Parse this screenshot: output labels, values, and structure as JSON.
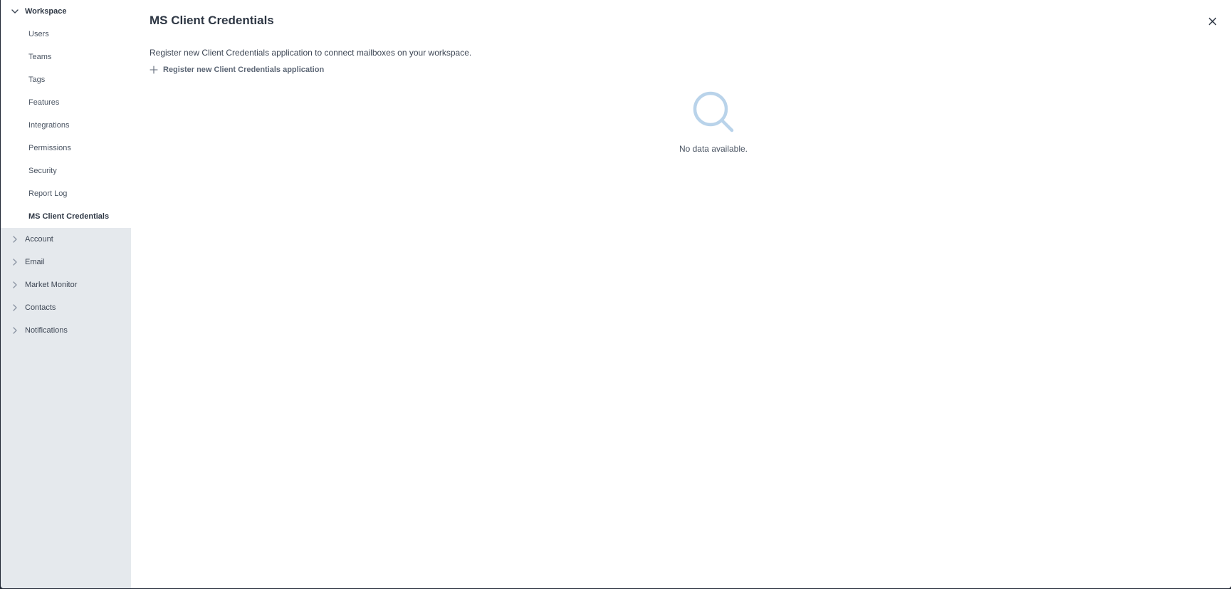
{
  "sidebar": {
    "workspace": {
      "label": "Workspace",
      "items": [
        {
          "label": "Users"
        },
        {
          "label": "Teams"
        },
        {
          "label": "Tags"
        },
        {
          "label": "Features"
        },
        {
          "label": "Integrations"
        },
        {
          "label": "Permissions"
        },
        {
          "label": "Security"
        },
        {
          "label": "Report Log"
        },
        {
          "label": "MS Client Credentials"
        }
      ]
    },
    "collapsed_sections": [
      {
        "label": "Account"
      },
      {
        "label": "Email"
      },
      {
        "label": "Market Monitor"
      },
      {
        "label": "Contacts"
      },
      {
        "label": "Notifications"
      }
    ]
  },
  "main": {
    "title": "MS Client Credentials",
    "description": "Register new Client Credentials application to connect mailboxes on your workspace.",
    "register_link": "Register new Client Credentials application",
    "empty_state": {
      "icon": "search-icon",
      "text": "No data available."
    },
    "close_icon": "close-icon"
  },
  "colors": {
    "sidebar_bg": "#e5e9ed",
    "accent_empty_icon": "#b9d3ea",
    "text_primary": "#2e3744"
  }
}
